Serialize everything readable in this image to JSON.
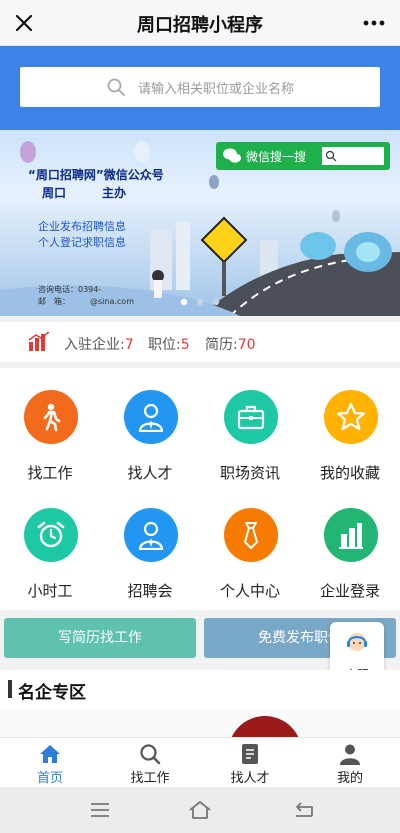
{
  "app": {
    "title": "周口招聘小程序"
  },
  "search": {
    "placeholder": "请输入相关职位或企业名称"
  },
  "banner": {
    "wechat_tag": "微信搜一搜",
    "line1": "“周口招聘网”微信公众号",
    "line2": "周口　　　主办",
    "line3": "企业发布招聘信息",
    "line4": "个人登记求职信息",
    "line5": "咨询电话：0394-",
    "line6": "邮　箱：　　　@sina.com"
  },
  "stats": {
    "companies_label": "入驻企业:",
    "companies_value": "7",
    "jobs_label": "职位:",
    "jobs_value": "5",
    "resumes_label": "简历:",
    "resumes_value": "70"
  },
  "grid": [
    {
      "label": "找工作",
      "color": "#f26a1b",
      "icon": "walking-person-icon"
    },
    {
      "label": "找人才",
      "color": "#2196f3",
      "icon": "person-tie-icon"
    },
    {
      "label": "职场资讯",
      "color": "#1ec8a5",
      "icon": "briefcase-icon"
    },
    {
      "label": "我的收藏",
      "color": "#ffb300",
      "icon": "star-icon"
    },
    {
      "label": "小时工",
      "color": "#1ec8a5",
      "icon": "alarm-clock-icon"
    },
    {
      "label": "招聘会",
      "color": "#2196f3",
      "icon": "person-tie-icon"
    },
    {
      "label": "个人中心",
      "color": "#f57c00",
      "icon": "necktie-icon"
    },
    {
      "label": "企业登录",
      "color": "#22b573",
      "icon": "building-icon"
    }
  ],
  "actions": {
    "left": "写简历找工作",
    "right": "免费发布职位"
  },
  "kefu": {
    "label": "客服"
  },
  "section": {
    "title": "名企专区"
  },
  "tabs": [
    {
      "label": "首页",
      "active": true
    },
    {
      "label": "找工作"
    },
    {
      "label": "找人才"
    },
    {
      "label": "我的"
    }
  ],
  "colors": {
    "accent": "#3d82e6",
    "stat_value": "#e53935",
    "active_tab": "#2f7ed8"
  }
}
